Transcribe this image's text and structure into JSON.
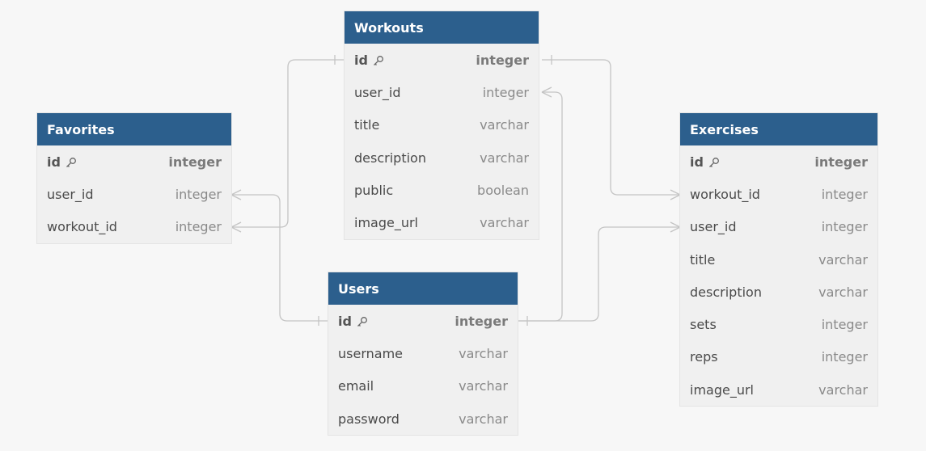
{
  "tables": {
    "workouts": {
      "name": "Workouts",
      "columns": [
        {
          "name": "id",
          "type": "integer",
          "pk": true
        },
        {
          "name": "user_id",
          "type": "integer"
        },
        {
          "name": "title",
          "type": "varchar"
        },
        {
          "name": "description",
          "type": "varchar"
        },
        {
          "name": "public",
          "type": "boolean"
        },
        {
          "name": "image_url",
          "type": "varchar"
        }
      ]
    },
    "favorites": {
      "name": "Favorites",
      "columns": [
        {
          "name": "id",
          "type": "integer",
          "pk": true
        },
        {
          "name": "user_id",
          "type": "integer"
        },
        {
          "name": "workout_id",
          "type": "integer"
        }
      ]
    },
    "exercises": {
      "name": "Exercises",
      "columns": [
        {
          "name": "id",
          "type": "integer",
          "pk": true
        },
        {
          "name": "workout_id",
          "type": "integer"
        },
        {
          "name": "user_id",
          "type": "integer"
        },
        {
          "name": "title",
          "type": "varchar"
        },
        {
          "name": "description",
          "type": "varchar"
        },
        {
          "name": "sets",
          "type": "integer"
        },
        {
          "name": "reps",
          "type": "integer"
        },
        {
          "name": "image_url",
          "type": "varchar"
        }
      ]
    },
    "users": {
      "name": "Users",
      "columns": [
        {
          "name": "id",
          "type": "integer",
          "pk": true
        },
        {
          "name": "username",
          "type": "varchar"
        },
        {
          "name": "email",
          "type": "varchar"
        },
        {
          "name": "password",
          "type": "varchar"
        }
      ]
    }
  },
  "relationships": [
    {
      "from": "favorites.workout_id",
      "to": "workouts.id",
      "cardinality": "many-to-one"
    },
    {
      "from": "favorites.user_id",
      "to": "users.id",
      "cardinality": "many-to-one"
    },
    {
      "from": "workouts.user_id",
      "to": "users.id",
      "cardinality": "many-to-one"
    },
    {
      "from": "exercises.workout_id",
      "to": "workouts.id",
      "cardinality": "many-to-one"
    },
    {
      "from": "exercises.user_id",
      "to": "users.id",
      "cardinality": "many-to-one"
    }
  ],
  "icons": {
    "primary_key": "key-icon"
  },
  "colors": {
    "header": "#2c5f8d",
    "body": "#f0f0f0",
    "connector": "#c4c4c4",
    "background": "#f7f7f7"
  }
}
